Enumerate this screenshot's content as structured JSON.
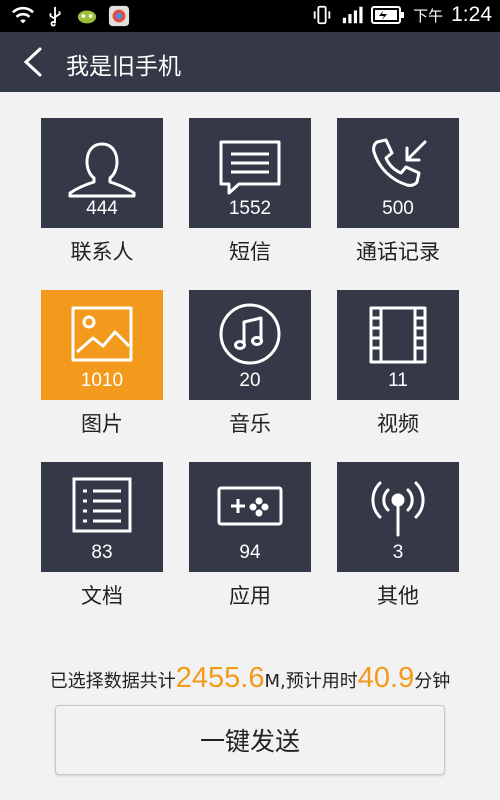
{
  "status_bar": {
    "ampm": "下午",
    "time": "1:24",
    "icons": [
      "wifi-icon",
      "usb-icon",
      "game-icon",
      "app-icon",
      "vibrate-icon",
      "signal-icon",
      "battery-icon"
    ]
  },
  "app_bar": {
    "title": "我是旧手机",
    "back_icon": "back-arrow-icon"
  },
  "tiles": [
    {
      "label": "联系人",
      "count": "444",
      "icon": "contact-icon"
    },
    {
      "label": "短信",
      "count": "1552",
      "icon": "message-icon"
    },
    {
      "label": "通话记录",
      "count": "500",
      "icon": "call-log-icon"
    },
    {
      "label": "图片",
      "count": "1010",
      "icon": "image-icon",
      "selected": true
    },
    {
      "label": "音乐",
      "count": "20",
      "icon": "music-icon"
    },
    {
      "label": "视频",
      "count": "11",
      "icon": "video-icon"
    },
    {
      "label": "文档",
      "count": "83",
      "icon": "document-icon"
    },
    {
      "label": "应用",
      "count": "94",
      "icon": "game-controller-icon"
    },
    {
      "label": "其他",
      "count": "3",
      "icon": "broadcast-icon"
    }
  ],
  "summary": {
    "prefix": "已选择数据共计",
    "size_value": "2455.6",
    "size_unit": "M,预计用时",
    "time_value": "40.9",
    "time_unit": "分钟"
  },
  "send_button": {
    "label": "一键发送"
  },
  "colors": {
    "tile": "#343847",
    "tile_selected": "#f39a1c",
    "accent": "#f39a1c",
    "background": "#f2f2f2"
  }
}
